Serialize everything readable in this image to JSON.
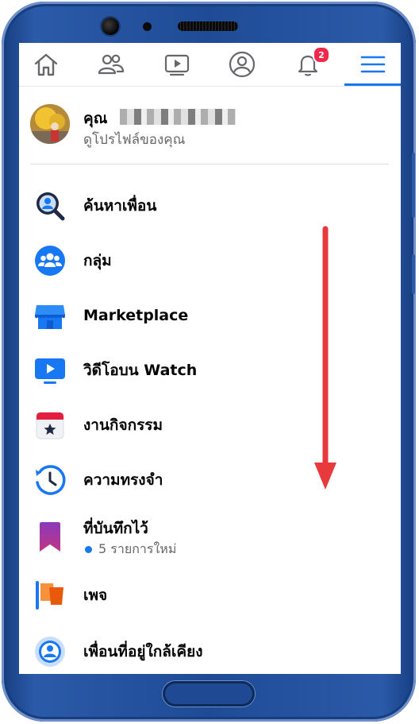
{
  "nav": {
    "tabs": [
      {
        "name": "home-icon"
      },
      {
        "name": "friends-icon"
      },
      {
        "name": "watch-icon"
      },
      {
        "name": "profile-icon"
      },
      {
        "name": "notifications-icon",
        "badge": "2"
      },
      {
        "name": "menu-icon",
        "active": true
      }
    ]
  },
  "profile": {
    "name": "คุณ",
    "subtitle": "ดูโปรไฟล์ของคุณ"
  },
  "menu": {
    "items": [
      {
        "label": "ค้นหาเพื่อน",
        "icon": "find-friends-icon"
      },
      {
        "label": "กลุ่ม",
        "icon": "groups-icon"
      },
      {
        "label": "Marketplace",
        "icon": "marketplace-icon"
      },
      {
        "label": "วิดีโอบน Watch",
        "icon": "watch-video-icon"
      },
      {
        "label": "งานกิจกรรม",
        "icon": "events-icon"
      },
      {
        "label": "ความทรงจำ",
        "icon": "memories-icon"
      },
      {
        "label": "ที่บันทึกไว้",
        "icon": "saved-icon",
        "sub": "5 รายการใหม่"
      },
      {
        "label": "เพจ",
        "icon": "pages-icon"
      },
      {
        "label": "เพื่อนที่อยู่ใกล้เคียง",
        "icon": "nearby-friends-icon"
      }
    ]
  },
  "colors": {
    "accent": "#1877f2",
    "badge": "#f02849",
    "frame": "#1f4b96",
    "annotation_arrow": "#e8393c"
  }
}
